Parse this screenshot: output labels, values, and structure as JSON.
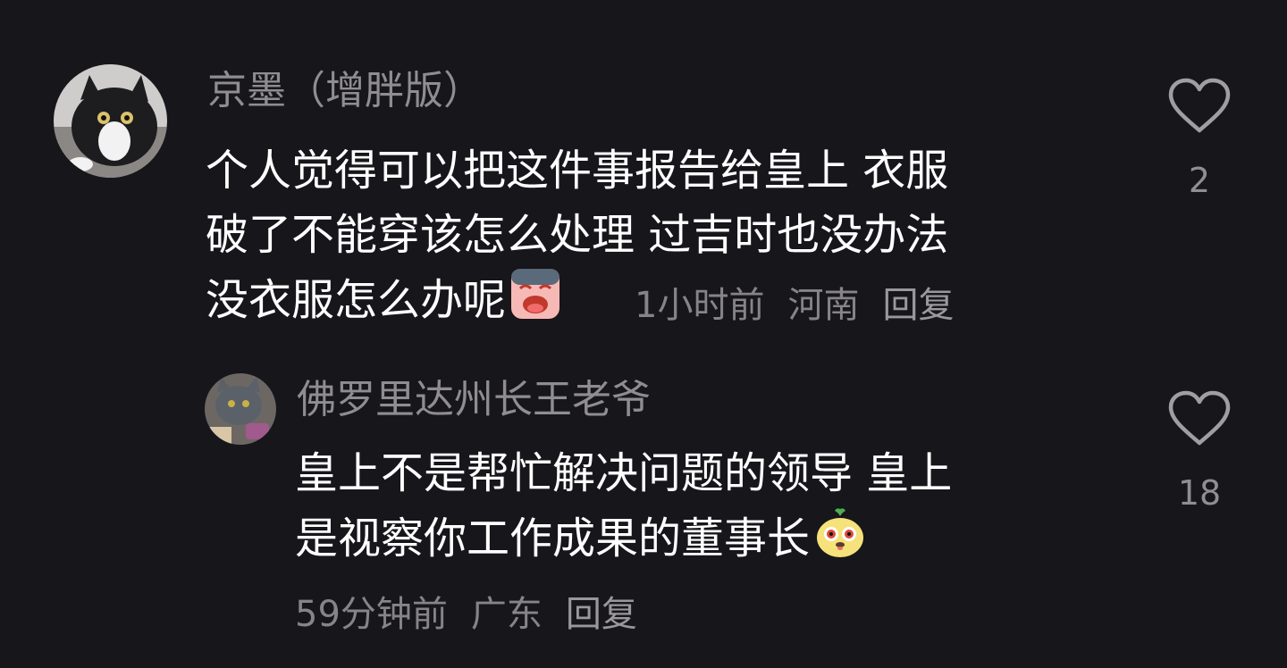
{
  "comment1": {
    "username": "京墨（增胖版）",
    "lines": [
      "个人觉得可以把这件事报告给皇上 衣服",
      "破了不能穿该怎么处理 过吉时也没办法",
      "没衣服怎么办呢"
    ],
    "time": "1小时前",
    "location": "河南",
    "reply_label": "回复",
    "like_count": "2",
    "avatar_icon": "cat-avatar-black-white",
    "emoji_icon": "crying-face-emoji"
  },
  "comment2": {
    "username": "佛罗里达州长王老爷",
    "lines": [
      "皇上不是帮忙解决问题的领导 皇上",
      "是视察你工作成果的董事长"
    ],
    "time": "59分钟前",
    "location": "广东",
    "reply_label": "回复",
    "like_count": "18",
    "avatar_icon": "cat-avatar-gray",
    "emoji_icon": "pear-face-emoji"
  },
  "colors": {
    "background": "#17161b",
    "text_primary": "#ffffff",
    "text_secondary": "#8f8d93"
  }
}
